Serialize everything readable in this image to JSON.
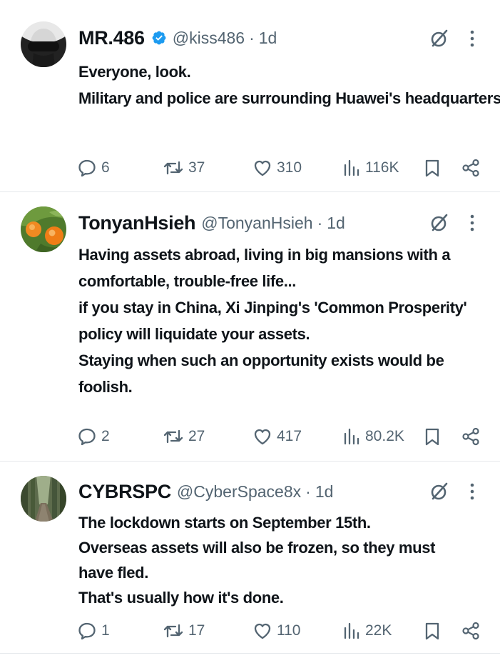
{
  "tweets": [
    {
      "name": "MR.486",
      "verified": true,
      "handle": "@kiss486",
      "separator": "·",
      "time": "1d",
      "lines": [
        "Everyone, look.",
        "Military and police are surrounding Huawei's headquarters."
      ],
      "replies": "6",
      "reposts": "37",
      "likes": "310",
      "views": "116K"
    },
    {
      "name": "TonyanHsieh",
      "verified": false,
      "handle": "@TonyanHsieh",
      "separator": "·",
      "time": "1d",
      "lines": [
        "Having assets abroad, living in big mansions with a",
        "comfortable, trouble-free life...",
        "if you stay in China, Xi Jinping's 'Common Prosperity'",
        "policy will liquidate your assets.",
        "Staying when such an opportunity exists would be",
        "foolish."
      ],
      "replies": "2",
      "reposts": "27",
      "likes": "417",
      "views": "80.2K"
    },
    {
      "name": "CYBRSPC",
      "verified": false,
      "handle": "@CyberSpace8x",
      "separator": "·",
      "time": "1d",
      "lines": [
        "The lockdown starts on September 15th.",
        "Overseas assets will also be frozen, so they must",
        "have fled.",
        "That's usually how it's done."
      ],
      "replies": "1",
      "reposts": "17",
      "likes": "110",
      "views": "22K"
    }
  ],
  "icons": {
    "reply": "speech-bubble-icon",
    "repost": "repost-arrows-icon",
    "like": "heart-icon",
    "views": "bar-chart-icon",
    "bookmark": "bookmark-icon",
    "share": "share-icon",
    "grok": "grok-slash-circle-icon",
    "more": "vertical-ellipsis-icon"
  },
  "colors": {
    "text": "#0f1419",
    "secondary": "#536471",
    "verified": "#1d9bf0",
    "divider": "#e6e9ec"
  }
}
